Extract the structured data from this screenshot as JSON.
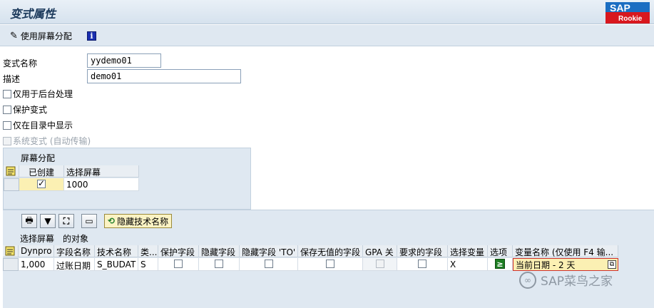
{
  "window": {
    "title": "变式属性"
  },
  "toolbar": {
    "use_screen_assignment": "使用屏幕分配"
  },
  "form": {
    "variant_name_label": "变式名称",
    "variant_name_value": "yydemo01",
    "description_label": "描述",
    "description_value": "demo01",
    "checkboxes": [
      {
        "label": "仅用于后台处理",
        "checked": false,
        "disabled": false
      },
      {
        "label": "保护变式",
        "checked": false,
        "disabled": false
      },
      {
        "label": "仅在目录中显示",
        "checked": false,
        "disabled": false
      },
      {
        "label": "系统变式 (自动传输)",
        "checked": false,
        "disabled": true
      }
    ]
  },
  "screen_assignment": {
    "title": "屏幕分配",
    "columns": [
      "已创建",
      "选择屏幕"
    ],
    "rows": [
      {
        "created": true,
        "screen": "1000"
      }
    ]
  },
  "objects": {
    "hide_tech_names_button": "隐藏技术名称",
    "section_label": "选择屏幕　的对象",
    "columns": [
      "Dynpro",
      "字段名称",
      "技术名称",
      "类...",
      "保护字段",
      "隐藏字段",
      "隐藏字段 'TO'",
      "保存无值的字段",
      "GPA 关",
      "要求的字段",
      "选择变量",
      "选项",
      "变量名称 (仅使用 F4 输..."
    ],
    "rows": [
      {
        "dynpro": "1,000",
        "field_name": "过账日期",
        "tech_name": "S_BUDAT",
        "type": "S",
        "protect": false,
        "hide": false,
        "hide_to": false,
        "save_no_value": false,
        "gpa": false,
        "required": false,
        "sel_variable": "X",
        "option": "≥",
        "variable_name": "当前日期 - 2 天"
      }
    ]
  },
  "watermark": "SAP菜鸟之家",
  "logo": {
    "top": "SAP",
    "bottom": "Rookie"
  }
}
